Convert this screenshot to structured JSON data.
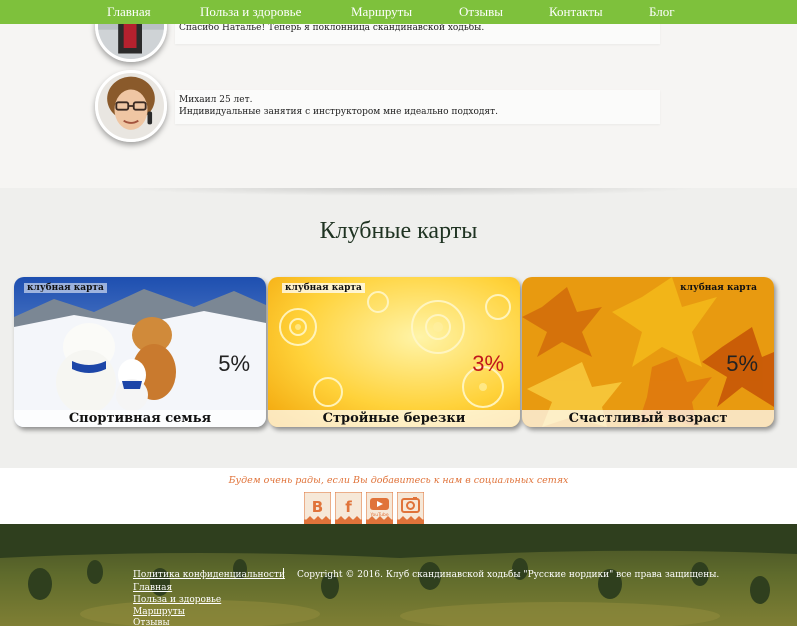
{
  "nav": {
    "items": [
      "Главная",
      "Польза и здоровье",
      "Маршруты",
      "Отзывы",
      "Контакты",
      "Блог"
    ]
  },
  "reviews": [
    {
      "text": "Спасибо Наталье! Теперь я поклонница скандинавской ходьбы."
    },
    {
      "author": "Михаил 25 лет.",
      "text": "Индивидуальные занятия с инструктором мне идеально подходят."
    }
  ],
  "club": {
    "title": "Клубные карты",
    "cards": [
      {
        "tag": "клубная карта",
        "percent": "5%",
        "name": "Спортивная семья"
      },
      {
        "tag": "клубная карта",
        "percent": "3%",
        "name": "Стройные березки"
      },
      {
        "tag": "клубная карта",
        "percent": "5%",
        "name": "Счастливый возраст"
      }
    ]
  },
  "social": {
    "text": "Будем очень рады, если Вы добавитесь к нам в социальных сетях",
    "icons": [
      "vk-icon",
      "facebook-icon",
      "youtube-icon",
      "instagram-icon"
    ],
    "youtube_label": "YouTube"
  },
  "footer": {
    "privacy": "Политика конфиденциальности",
    "copyright": "Copyright © 2016. Клуб скандинавской ходьбы \"Русские нордики\" все права защищены.",
    "links": [
      "Главная",
      "Польза и здоровье",
      "Маршруты",
      "Отзывы"
    ]
  },
  "colors": {
    "nav": "#7ec13c",
    "accent_orange": "#e0733a",
    "card_red_percent": "#c0161c"
  }
}
